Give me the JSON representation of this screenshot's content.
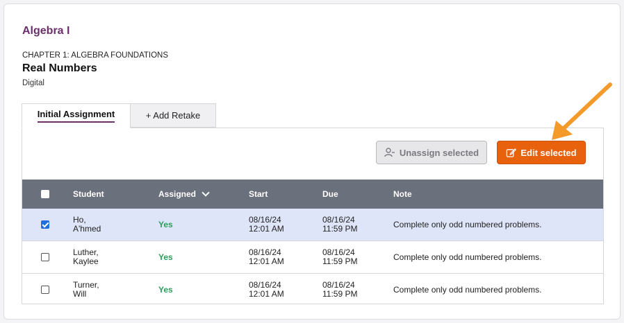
{
  "course": {
    "title": "Algebra I"
  },
  "lesson": {
    "chapter": "CHAPTER 1: ALGEBRA FOUNDATIONS",
    "title": "Real Numbers",
    "type": "Digital"
  },
  "tabs": [
    {
      "label": "Initial Assignment",
      "active": true
    },
    {
      "label": "+ Add Retake",
      "active": false
    }
  ],
  "actions": {
    "unassign_label": "Unassign selected",
    "unassign_icon": "user-minus-icon",
    "edit_label": "Edit selected",
    "edit_icon": "edit-icon",
    "edit_color": "#e8620e"
  },
  "table": {
    "headers": {
      "student": "Student",
      "assigned": "Assigned",
      "start": "Start",
      "due": "Due",
      "note": "Note"
    },
    "rows": [
      {
        "checked": true,
        "student_last": "Ho,",
        "student_first": "A'hmed",
        "assigned": "Yes",
        "start_date": "08/16/24",
        "start_time": "12:01 AM",
        "due_date": "08/16/24",
        "due_time": "11:59 PM",
        "note": "Complete only odd numbered problems."
      },
      {
        "checked": false,
        "student_last": "Luther,",
        "student_first": "Kaylee",
        "assigned": "Yes",
        "start_date": "08/16/24",
        "start_time": "12:01 AM",
        "due_date": "08/16/24",
        "due_time": "11:59 PM",
        "note": "Complete only odd numbered problems."
      },
      {
        "checked": false,
        "student_last": "Turner,",
        "student_first": "Will",
        "assigned": "Yes",
        "start_date": "08/16/24",
        "start_time": "12:01 AM",
        "due_date": "08/16/24",
        "due_time": "11:59 PM",
        "note": "Complete only odd numbered problems."
      }
    ]
  },
  "annotation": {
    "arrow_color": "#f39a2b"
  }
}
